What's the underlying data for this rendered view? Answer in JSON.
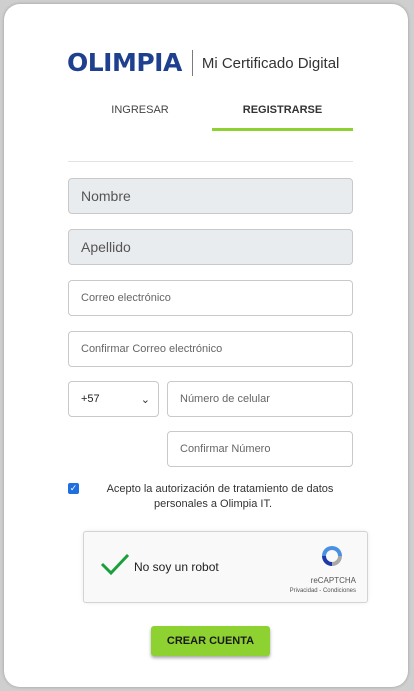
{
  "brand": {
    "logo": "OLIMPIA",
    "product": "Mi Certificado Digital"
  },
  "tabs": {
    "login": "INGRESAR",
    "register": "REGISTRARSE",
    "active": "register"
  },
  "form": {
    "nombre": "Nombre",
    "apellido": "Apellido",
    "correo_placeholder": "Correo electrónico",
    "confirm_correo_placeholder": "Confirmar Correo electrónico",
    "country_code": "+57",
    "celular_placeholder": "Número de celular",
    "confirm_celular_placeholder": "Confirmar Número",
    "consent_checked": true,
    "consent_text": "Acepto la autorización de tratamiento de datos personales a Olimpia IT."
  },
  "captcha": {
    "label": "No soy un robot",
    "brand": "reCAPTCHA",
    "links": "Privacidad - Condiciones"
  },
  "submit_label": "CREAR CUENTA",
  "colors": {
    "accent": "#8ed231",
    "logo": "#1f3f8f",
    "checkbox": "#1e6fe0"
  }
}
